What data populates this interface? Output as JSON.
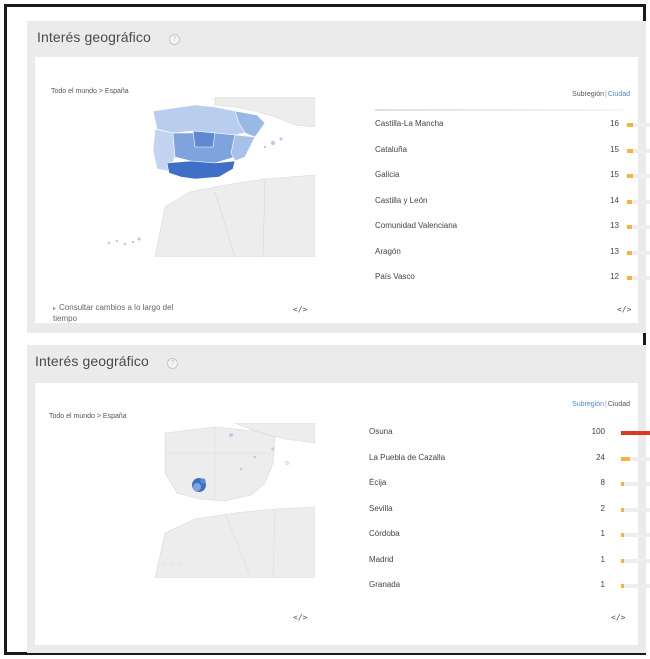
{
  "panels": [
    {
      "title": "Interés geográfico",
      "help": "?",
      "breadcrumb": "Todo el mundo > España",
      "toggle": {
        "subregion": "Subregión",
        "separator": "|",
        "city": "Ciudad"
      },
      "history_link": "Consultar cambios a lo largo del tiempo",
      "embed": "</>",
      "rows": [
        {
          "name": "Castilla-La Mancha",
          "value": "16",
          "fraction": 0.16
        },
        {
          "name": "Cataluña",
          "value": "15",
          "fraction": 0.15
        },
        {
          "name": "Galicia",
          "value": "15",
          "fraction": 0.15
        },
        {
          "name": "Castilla y León",
          "value": "14",
          "fraction": 0.14
        },
        {
          "name": "Comunidad Valenciana",
          "value": "13",
          "fraction": 0.13
        },
        {
          "name": "Aragón",
          "value": "13",
          "fraction": 0.13
        },
        {
          "name": "País Vasco",
          "value": "12",
          "fraction": 0.12
        }
      ]
    },
    {
      "title": "Interés geográfico",
      "help": "?",
      "breadcrumb": "Todo el mundo > España",
      "toggle": {
        "subregion": "Subregión",
        "separator": "|",
        "city": "Ciudad"
      },
      "embed": "</>",
      "rows": [
        {
          "name": "Osuna",
          "value": "100",
          "fraction": 1.0
        },
        {
          "name": "La Puebla de Cazalla",
          "value": "24",
          "fraction": 0.24
        },
        {
          "name": "Écija",
          "value": "8",
          "fraction": 0.08
        },
        {
          "name": "Sevilla",
          "value": "2",
          "fraction": 0.02
        },
        {
          "name": "Córdoba",
          "value": "1",
          "fraction": 0.01
        },
        {
          "name": "Madrid",
          "value": "1",
          "fraction": 0.01
        },
        {
          "name": "Granada",
          "value": "1",
          "fraction": 0.01
        }
      ]
    }
  ],
  "colors": {
    "bar_low": "#f2b640",
    "bar_high": "#d9391f",
    "map_dark": "#3f6fc6",
    "map_mid": "#7fa4dd",
    "map_light": "#b9cdee",
    "land": "#ededed"
  }
}
